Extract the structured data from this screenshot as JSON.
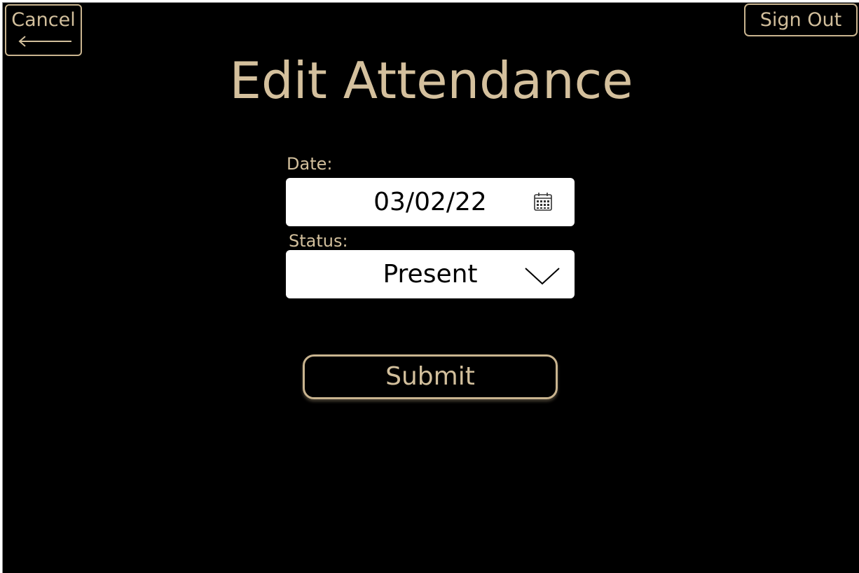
{
  "header": {
    "cancel_label": "Cancel",
    "sign_out_label": "Sign Out"
  },
  "page": {
    "title": "Edit Attendance"
  },
  "form": {
    "date_label": "Date:",
    "date_value": "03/02/22",
    "status_label": "Status:",
    "status_value": "Present",
    "submit_label": "Submit"
  },
  "icons": {
    "cancel": "arrow-left-icon",
    "date": "calendar-icon",
    "status": "chevron-down-icon"
  },
  "colors": {
    "background": "#000000",
    "accent": "#d2bf9c",
    "field_background": "#ffffff",
    "field_text": "#000000"
  }
}
